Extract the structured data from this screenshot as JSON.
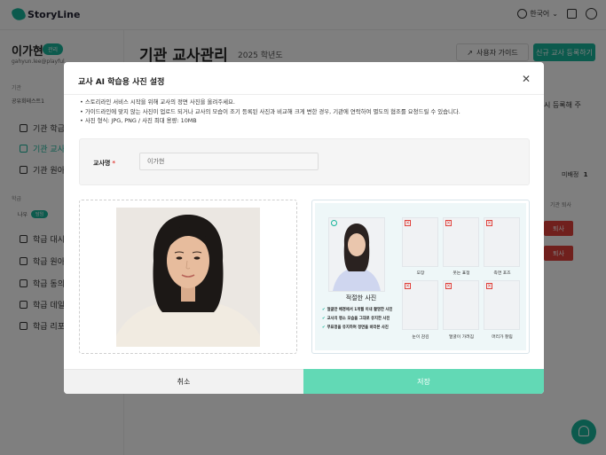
{
  "app": {
    "logo_text": "StoryLine",
    "language": "한국어",
    "brand_color": "#18b59a"
  },
  "sidebar": {
    "user_name": "이가현",
    "user_badge": "관리",
    "user_email": "gahyun.lee@playful...",
    "section_institution": "기관",
    "school_pill": "공유회테스트1",
    "institution_items": [
      {
        "label": "기관 학급관리",
        "icon": "building-icon"
      },
      {
        "label": "기관 교사관리",
        "icon": "teacher-icon"
      },
      {
        "label": "기관 원아관리",
        "icon": "child-icon"
      }
    ],
    "section_class": "학급",
    "me_label": "나우",
    "me_badge": "담임",
    "class_items": [
      {
        "label": "학급 대시보드",
        "icon": "dashboard-icon"
      },
      {
        "label": "학급 원아관리",
        "icon": "child-icon"
      },
      {
        "label": "학급 동의서",
        "icon": "folder-icon"
      },
      {
        "label": "학급 데일리",
        "icon": "folder-icon"
      },
      {
        "label": "학급 리포트",
        "icon": "file-icon"
      }
    ]
  },
  "main": {
    "title": "기관 교사관리",
    "year": "2025 학년도",
    "guide_button": "사용자 가이드",
    "register_button": "신규 교사 등록하기",
    "note": "시 등록해 주",
    "count_label": "미배정",
    "count_value": "1",
    "column_header": "기관 퇴사",
    "delete_buttons": [
      "퇴사",
      "퇴사"
    ]
  },
  "modal": {
    "title": "교사 AI 학습용 사진 설정",
    "notes": [
      "스토리라인 서비스 시작을 위해 교사의 정면 사진을 올려주세요.",
      "가이드라인에 맞지 않는 사진이 업로드 되거나 교사의 모습이 조기 등록된 사진과 비교해 크게 변한 경우, 기관에 연락하여 별도의 협조를 요청드릴 수 있습니다.",
      "사진 형식: JPG, PNG / 사진 최대 용량: 10MB"
    ],
    "teacher_label": "교사명",
    "required_mark": "*",
    "teacher_value": "이가현",
    "guide": {
      "good_title": "적절한 사진",
      "good_points": [
        "얼굴만 배경에서 1개월 이내 촬영한 사진",
        "교사의 평소 모습을 그대로 유지한 사진",
        "무표정을 유지하며 정면을 바라본 사진"
      ],
      "bad_examples": [
        "모장",
        "웃는 표정",
        "측면 포즈",
        "눈이 감김",
        "얼굴이 가려짐",
        "머리가 잘림"
      ]
    },
    "cancel_label": "취소",
    "save_label": "저장"
  }
}
